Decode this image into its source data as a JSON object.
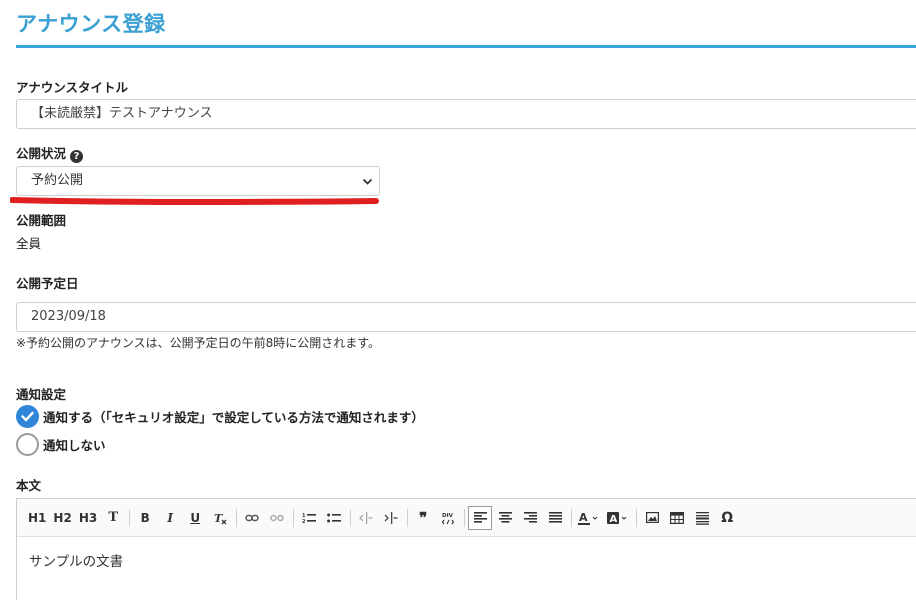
{
  "page": {
    "title": "アナウンス登録"
  },
  "title_field": {
    "label": "アナウンスタイトル",
    "value": "【未読厳禁】テストアナウンス"
  },
  "publish_status": {
    "label": "公開状況",
    "help_icon": "?",
    "selected": "予約公開"
  },
  "publish_scope": {
    "label": "公開範囲",
    "value": "全員"
  },
  "publish_date": {
    "label": "公開予定日",
    "value": "2023/09/18",
    "note": "※予約公開のアナウンスは、公開予定日の午前8時に公開されます。"
  },
  "notification": {
    "label": "通知設定",
    "options": [
      {
        "label": "通知する（「セキュリオ設定」で設定している方法で通知されます）",
        "checked": true
      },
      {
        "label": "通知しない",
        "checked": false
      }
    ]
  },
  "body": {
    "label": "本文",
    "content": "サンプルの文書",
    "toolbar": {
      "h1": "H1",
      "h2": "H2",
      "h3": "H3",
      "text": "T",
      "bold": "B",
      "italic": "I",
      "underline": "U",
      "icons": [
        "clear-format-icon",
        "link-icon",
        "unlink-icon",
        "ordered-list-icon",
        "bullet-list-icon",
        "outdent-icon",
        "indent-icon",
        "blockquote-icon",
        "div-icon",
        "align-left-icon",
        "align-center-icon",
        "align-right-icon",
        "align-justify-icon",
        "text-color-icon",
        "background-color-icon",
        "image-icon",
        "table-icon",
        "horizontal-rule-icon",
        "special-char-icon"
      ]
    }
  },
  "colors": {
    "accent": "#3a9fd3",
    "radio_checked": "#2f86d8",
    "annotation_red": "#e02020"
  }
}
